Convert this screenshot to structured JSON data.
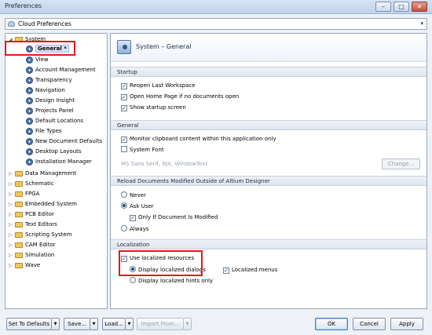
{
  "window": {
    "title": "Preferences",
    "controls": [
      "–",
      "□",
      "✕"
    ]
  },
  "profile_select": {
    "value": "Cloud Preferences"
  },
  "tree": {
    "system": "System",
    "system_children": [
      "General *",
      "View",
      "Account Management",
      "Transparency",
      "Navigation",
      "Design Insight",
      "Projects Panel",
      "Default Locations",
      "File Types",
      "New Document Defaults",
      "Desktop Layouts",
      "Installation Manager"
    ],
    "top_level": [
      "Data Management",
      "Schematic",
      "FPGA",
      "Embedded System",
      "PCB Editor",
      "Text Editors",
      "Scripting System",
      "CAM Editor",
      "Simulation",
      "Wave"
    ]
  },
  "panel": {
    "title": "System – General",
    "startup": {
      "header": "Startup",
      "options": [
        "Reopen Last Workspace",
        "Open Home Page if no documents open",
        "Show startup screen"
      ]
    },
    "general": {
      "header": "General",
      "monitor": "Monitor clipboard content within this application only",
      "system_font": "System Font",
      "font_desc": "MS Sans Serif, 8pt, WindowText",
      "change": "Change..."
    },
    "reload": {
      "header": "Reload Documents Modified Outside of Altium Designer",
      "never": "Never",
      "ask": "Ask User",
      "only_if": "Only If Document Is Modified",
      "always": "Always"
    },
    "localization": {
      "header": "Localization",
      "use": "Use localized resources",
      "dialogs": "Display localized dialogs",
      "menus": "Localized menus",
      "hints": "Display localized hints only"
    }
  },
  "buttons": {
    "defaults": "Set To Defaults",
    "save": "Save...",
    "load": "Load...",
    "import": "Import From...",
    "ok": "OK",
    "cancel": "Cancel",
    "apply": "Apply"
  },
  "check_mark": "✓"
}
